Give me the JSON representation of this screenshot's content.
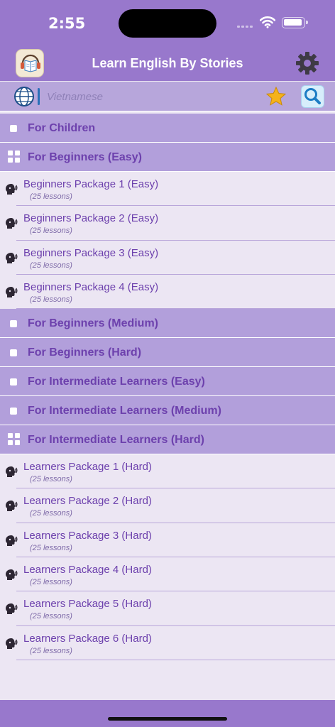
{
  "status_bar": {
    "time": "2:55"
  },
  "app": {
    "title": "Learn English By Stories"
  },
  "search": {
    "placeholder": "Vietnamese"
  },
  "sections": [
    {
      "label": "For Children",
      "expanded": false,
      "items": []
    },
    {
      "label": "For Beginners (Easy)",
      "expanded": true,
      "items": [
        {
          "title": "Beginners Package 1 (Easy)",
          "subtitle": "(25 lessons)"
        },
        {
          "title": "Beginners Package 2 (Easy)",
          "subtitle": "(25 lessons)"
        },
        {
          "title": "Beginners Package 3 (Easy)",
          "subtitle": "(25 lessons)"
        },
        {
          "title": "Beginners Package 4 (Easy)",
          "subtitle": "(25 lessons)"
        }
      ]
    },
    {
      "label": "For Beginners (Medium)",
      "expanded": false,
      "items": []
    },
    {
      "label": "For Beginners (Hard)",
      "expanded": false,
      "items": []
    },
    {
      "label": "For Intermediate Learners (Easy)",
      "expanded": false,
      "items": []
    },
    {
      "label": "For Intermediate Learners (Medium)",
      "expanded": false,
      "items": []
    },
    {
      "label": "For Intermediate Learners (Hard)",
      "expanded": true,
      "items": [
        {
          "title": "Learners Package 1 (Hard)",
          "subtitle": "(25 lessons)"
        },
        {
          "title": "Learners Package 2 (Hard)",
          "subtitle": "(25 lessons)"
        },
        {
          "title": "Learners Package 3 (Hard)",
          "subtitle": "(25 lessons)"
        },
        {
          "title": "Learners Package 4 (Hard)",
          "subtitle": "(25 lessons)"
        },
        {
          "title": "Learners Package 5 (Hard)",
          "subtitle": "(25 lessons)"
        },
        {
          "title": "Learners Package 6 (Hard)",
          "subtitle": "(25 lessons)"
        }
      ]
    }
  ],
  "icons": {
    "status": [
      "cellular-signal-icon",
      "wifi-icon",
      "battery-icon"
    ],
    "nav": [
      "app-logo-icon",
      "settings-gear-icon"
    ],
    "search": [
      "language-globe-icon",
      "favorites-star-icon",
      "search-icon"
    ],
    "sections": {
      "collapsed": "checkbox-icon",
      "expanded": "grid-icon"
    },
    "lesson": "listening-head-icon"
  },
  "colors": {
    "bar": "#9878CC",
    "section_header": "#B29FDB",
    "row_background": "#ECE6F3",
    "accent_text": "#6D41AD",
    "separator": "#B9A6DA"
  }
}
